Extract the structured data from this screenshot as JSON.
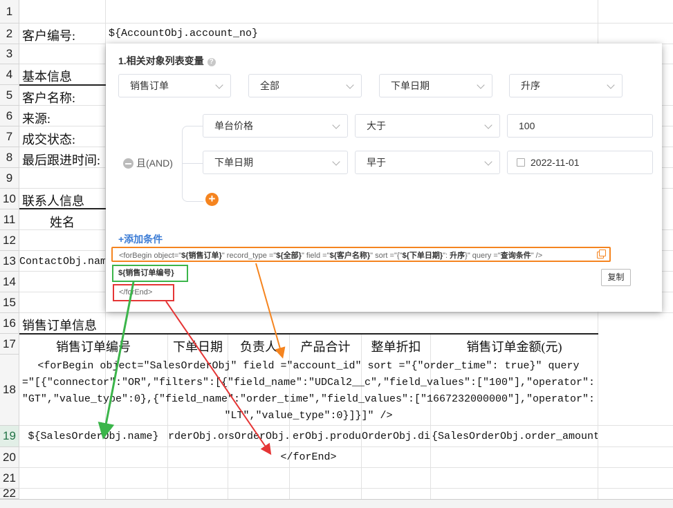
{
  "rows": [
    "1",
    "2",
    "3",
    "4",
    "5",
    "6",
    "7",
    "8",
    "9",
    "10",
    "11",
    "12",
    "13",
    "14",
    "15",
    "16",
    "17",
    "18",
    "19",
    "20",
    "21",
    "22"
  ],
  "cells": {
    "r2_label": "客户编号:",
    "r2_value": "${AccountObj.account_no}",
    "r4": "基本信息",
    "r5": "客户名称:",
    "r6": "来源:",
    "r7": "成交状态:",
    "r8": "最后跟进时间:",
    "r10": "联系人信息",
    "r11": "姓名",
    "r13": "ContactObj.nam",
    "r16": "销售订单信息"
  },
  "headers17": [
    "销售订单编号",
    "下单日期",
    "负责人",
    "产品合计",
    "整单折扣",
    "销售订单金额(元)"
  ],
  "r18_lines": [
    "<forBegin object=\"SalesOrderObj\"  field =\"account_id\" sort =\"{\"order_time\": true}\" query",
    "=\"[{\"connector\":\"OR\",\"filters\":[{\"field_name\":\"UDCal2__c\",\"field_values\":[\"100\"],\"operator\":",
    "\"GT\",\"value_type\":0},{\"field_name\":\"order_time\",\"field_values\":[\"1667232000000\"],\"operator\":",
    "\"LT\",\"value_type\":0}]}]\" />"
  ],
  "r19": [
    "${SalesOrderObj.name}",
    "rderObj.ore",
    "sOrderObj.",
    "erObj.produ",
    "OrderObj.di",
    "{SalesOrderObj.order_amount"
  ],
  "r20": "</forEnd>",
  "dialog": {
    "title": "1.相关对象列表变量",
    "selects_row1": [
      "销售订单",
      "全部",
      "下单日期",
      "升序"
    ],
    "and_label": "且(AND)",
    "cond1": [
      "单台价格",
      "大于",
      "100"
    ],
    "cond2": [
      "下单日期",
      "早于",
      "2022-11-01"
    ],
    "add_condition": "+添加条件",
    "code_line": {
      "p1": "<forBegin object=\"",
      "v1": "${销售订单}",
      "p2": "\" record_type =\"",
      "v2": "${全部}",
      "p3": "\" field =\"",
      "v3": "${客户名称}",
      "p4": "\" sort =\"{\"",
      "v4": "${下单日期}",
      "p5": "\": ",
      "v5": "升序",
      "p6": "}\" query =\"",
      "v6": "查询条件",
      "p7": "\" />"
    },
    "code_var": "${销售订单编号}",
    "code_end": "</forEnd>",
    "copy_button": "复制"
  },
  "colors": {
    "orange": "#f5841f",
    "green": "#3bb54a",
    "red": "#e53535",
    "link": "#3a7bd5"
  }
}
